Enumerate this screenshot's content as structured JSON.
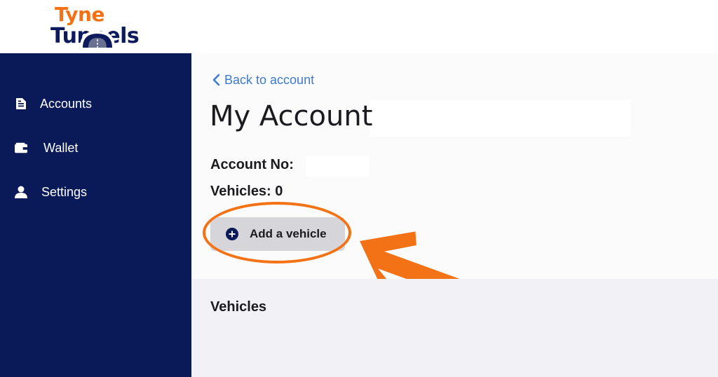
{
  "brand": {
    "logo_line1": "Tyne",
    "logo_line2": "Tunnels",
    "colors": {
      "orange": "#f47216",
      "navy": "#0a1a58",
      "link": "#3d7bd0"
    }
  },
  "sidebar": {
    "items": [
      {
        "label": "Accounts",
        "icon": "document-icon"
      },
      {
        "label": "Wallet",
        "icon": "wallet-icon"
      },
      {
        "label": "Settings",
        "icon": "user-icon"
      }
    ]
  },
  "main": {
    "back_link": "Back to account",
    "title": "My Account",
    "account_no_label": "Account No:",
    "vehicles_count_label": "Vehicles: 0",
    "add_vehicle_button": "Add a vehicle",
    "vehicles_section_title": "Vehicles"
  },
  "annotation": {
    "highlight": "add-vehicle-button",
    "arrow_direction": "pointing-left-up"
  }
}
